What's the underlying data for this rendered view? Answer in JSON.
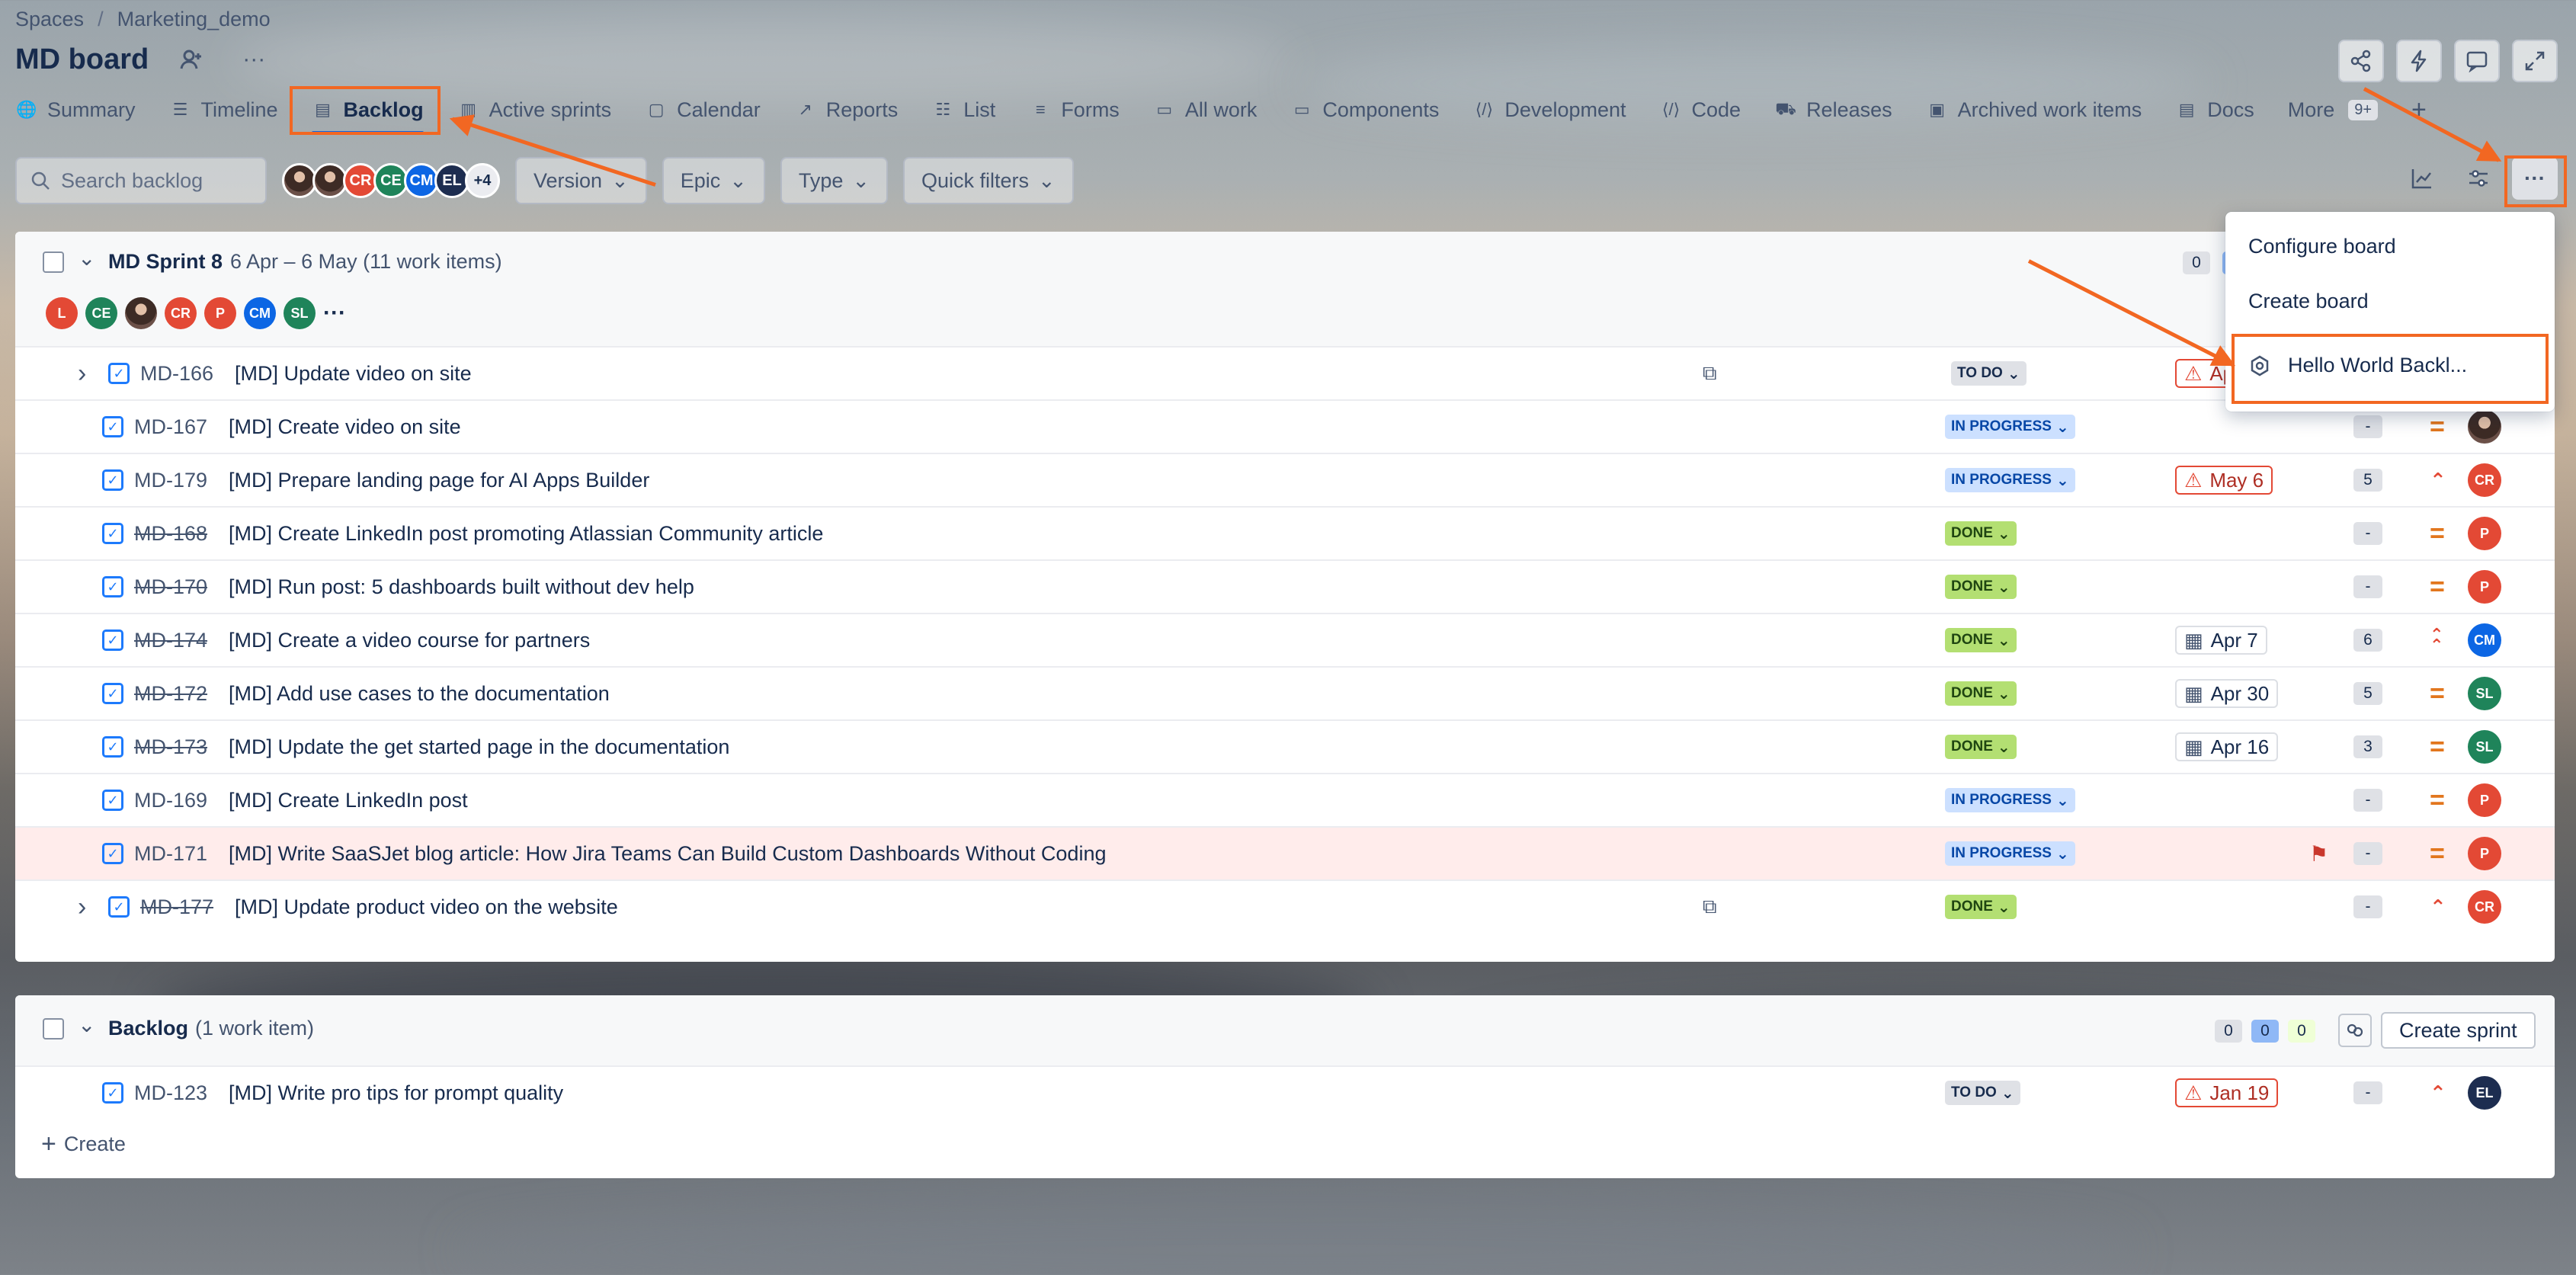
{
  "breadcrumb": {
    "spaces": "Spaces",
    "separator": "/",
    "project": "Marketing_demo"
  },
  "board_title": "MD board",
  "tabs": [
    {
      "label": "Summary",
      "icon": "globe-icon"
    },
    {
      "label": "Timeline",
      "icon": "timeline-icon"
    },
    {
      "label": "Backlog",
      "icon": "backlog-icon"
    },
    {
      "label": "Active sprints",
      "icon": "board-icon"
    },
    {
      "label": "Calendar",
      "icon": "calendar-icon"
    },
    {
      "label": "Reports",
      "icon": "reports-icon"
    },
    {
      "label": "List",
      "icon": "list-icon"
    },
    {
      "label": "Forms",
      "icon": "forms-icon"
    },
    {
      "label": "All work",
      "icon": "all-work-icon"
    },
    {
      "label": "Components",
      "icon": "components-icon"
    },
    {
      "label": "Development",
      "icon": "development-icon"
    },
    {
      "label": "Code",
      "icon": "code-icon"
    },
    {
      "label": "Releases",
      "icon": "releases-icon"
    },
    {
      "label": "Archived work items",
      "icon": "archive-icon"
    },
    {
      "label": "Docs",
      "icon": "docs-icon"
    },
    {
      "label": "More",
      "icon": "more-icon"
    }
  ],
  "more_badge": "9+",
  "toolbar": {
    "search_placeholder": "Search backlog",
    "avatars": [
      "",
      "",
      "CR",
      "CE",
      "CM",
      "EL"
    ],
    "avatars_more": "+4",
    "filters": [
      "Version",
      "Epic",
      "Type",
      "Quick filters"
    ]
  },
  "sprint": {
    "name": "MD Sprint 8",
    "dates": "6 Apr – 6 May (11 work items)",
    "count_todo": "0",
    "participants": [
      "L",
      "CE",
      "",
      "CR",
      "P",
      "CM",
      "SL"
    ]
  },
  "status_labels": {
    "todo": "TO DO",
    "in_progress": "IN PROGRESS",
    "done": "DONE"
  },
  "sprint_items": [
    {
      "key": "MD-166",
      "summary": "[MD] Update video on site",
      "status": "TO DO",
      "date": "Apr",
      "est": "",
      "prio": "",
      "assignee": ""
    },
    {
      "key": "MD-167",
      "summary": "[MD] Create video on site",
      "status": "IN PROGRESS",
      "date": "",
      "est": "-",
      "prio": "medium",
      "assignee": ""
    },
    {
      "key": "MD-179",
      "summary": "[MD] Prepare landing page for AI Apps Builder",
      "status": "IN PROGRESS",
      "date": "May 6",
      "est": "5",
      "prio": "high",
      "assignee": "CR"
    },
    {
      "key": "MD-168",
      "summary": "[MD] Create LinkedIn post promoting Atlassian Community article",
      "status": "DONE",
      "date": "",
      "est": "-",
      "prio": "medium",
      "assignee": "P"
    },
    {
      "key": "MD-170",
      "summary": "[MD] Run post: 5 dashboards built without dev help",
      "status": "DONE",
      "date": "",
      "est": "-",
      "prio": "medium",
      "assignee": "P"
    },
    {
      "key": "MD-174",
      "summary": "[MD] Create a video course for partners",
      "status": "DONE",
      "date": "Apr 7",
      "est": "6",
      "prio": "highest",
      "assignee": "CM"
    },
    {
      "key": "MD-172",
      "summary": "[MD] Add use cases to the documentation",
      "status": "DONE",
      "date": "Apr 30",
      "est": "5",
      "prio": "medium",
      "assignee": "SL"
    },
    {
      "key": "MD-173",
      "summary": "[MD] Update the get started page in the documentation",
      "status": "DONE",
      "date": "Apr 16",
      "est": "3",
      "prio": "medium",
      "assignee": "SL"
    },
    {
      "key": "MD-169",
      "summary": "[MD] Create LinkedIn post",
      "status": "IN PROGRESS",
      "date": "",
      "est": "-",
      "prio": "medium",
      "assignee": "P"
    },
    {
      "key": "MD-171",
      "summary": "[MD] Write SaaSJet blog article: How Jira Teams Can Build Custom Dashboards Without Coding",
      "status": "IN PROGRESS",
      "date": "",
      "est": "-",
      "prio": "medium",
      "assignee": "P"
    },
    {
      "key": "MD-177",
      "summary": "[MD] Update product video on the website",
      "status": "DONE",
      "date": "",
      "est": "-",
      "prio": "high",
      "assignee": "CR"
    }
  ],
  "backlog": {
    "name": "Backlog",
    "count": "(1 work item)",
    "pills": [
      "0",
      "0",
      "0"
    ],
    "create_sprint": "Create sprint",
    "item": {
      "key": "MD-123",
      "summary": "[MD] Write pro tips for prompt quality",
      "status": "TO DO",
      "date": "Jan 19",
      "est": "-",
      "prio": "high",
      "assignee": "EL"
    },
    "create_label": "Create"
  },
  "menu": {
    "items": [
      "Configure board",
      "Create board",
      "Hello World Backl..."
    ]
  },
  "colors": {
    "accent": "#0c66e4",
    "annotation": "#f26722",
    "av_red": "#e34935",
    "av_green": "#1f845a",
    "av_blue": "#0c66e4",
    "av_navy": "#1d2d50"
  }
}
